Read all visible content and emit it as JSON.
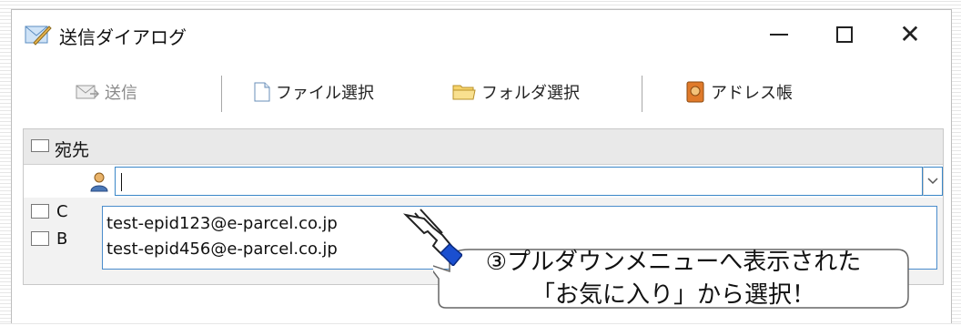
{
  "window": {
    "title": "送信ダイアログ"
  },
  "toolbar": {
    "send_label": "送信",
    "file_label": "ファイル選択",
    "folder_label": "フォルダ選択",
    "address_label": "アドレス帳"
  },
  "recipients": {
    "to_label": "宛先",
    "to_value": "",
    "cc_label": "C",
    "bcc_label": "B"
  },
  "dropdown": {
    "options": [
      "test-epid123@e-parcel.co.jp",
      "test-epid456@e-parcel.co.jp"
    ]
  },
  "callout": {
    "line1": "③プルダウンメニューへ表示された",
    "line2": "「お気に入り」から選択！"
  },
  "colors": {
    "accent": "#3a87c8",
    "hand": "#1a4fd0"
  }
}
